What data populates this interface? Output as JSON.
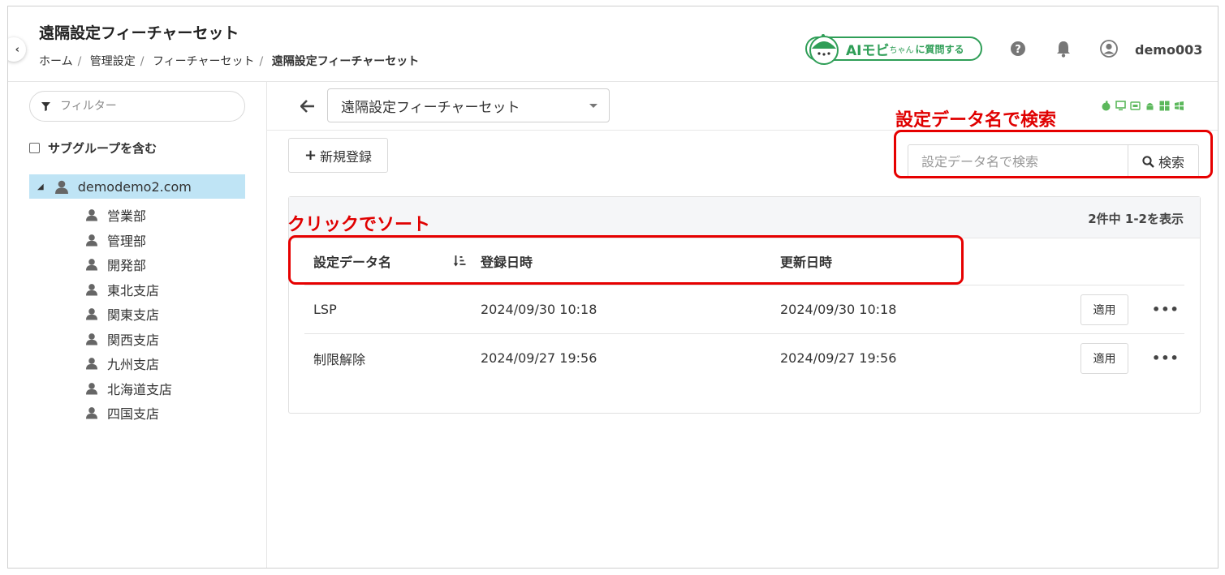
{
  "header": {
    "title": "遠隔設定フィーチャーセット",
    "breadcrumb": [
      "ホーム",
      "管理設定",
      "フィーチャーセット",
      "遠隔設定フィーチャーセット"
    ],
    "ai_button": {
      "big": "AIモビ",
      "small": "ちゃん",
      "rest": "に質問する"
    },
    "username": "demo003"
  },
  "sidebar": {
    "filter_placeholder": "フィルター",
    "include_subgroups": "サブグループを含む",
    "root": "demodemo2.com",
    "items": [
      "営業部",
      "管理部",
      "開発部",
      "東北支店",
      "関東支店",
      "関西支店",
      "九州支店",
      "北海道支店",
      "四国支店"
    ]
  },
  "main": {
    "feature_select": "遠隔設定フィーチャーセット",
    "new_button": "新規登録",
    "search_placeholder": "設定データ名で検索",
    "search_button": "検索",
    "count_text": "2件中 1-2を表示",
    "columns": [
      "設定データ名",
      "登録日時",
      "更新日時"
    ],
    "rows": [
      {
        "name": "LSP",
        "created": "2024/09/30 10:18",
        "updated": "2024/09/30 10:18",
        "apply": "適用"
      },
      {
        "name": "制限解除",
        "created": "2024/09/27 19:56",
        "updated": "2024/09/27 19:56",
        "apply": "適用"
      }
    ]
  },
  "annotations": {
    "search_note": "設定データ名で検索",
    "sort_note": "クリックでソート"
  },
  "colors": {
    "accent_green": "#2f9e57",
    "annotation_red": "#e60000",
    "tree_selected": "#bfe4f5"
  }
}
